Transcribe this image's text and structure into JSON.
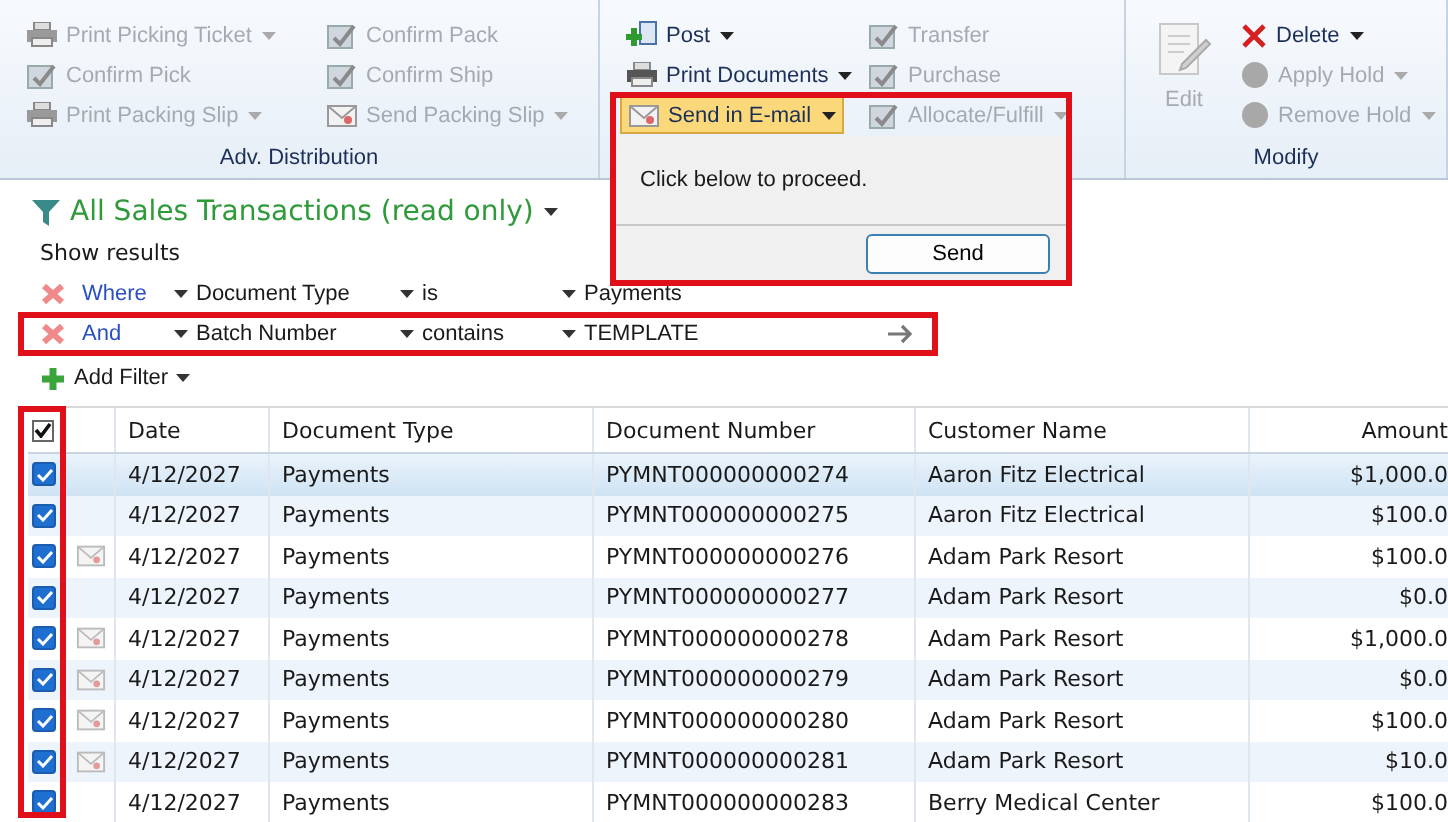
{
  "ribbon": {
    "groups": [
      {
        "label": "Adv. Distribution",
        "items": [
          {
            "label": "Print Picking Ticket",
            "dropdown": true,
            "disabled": true
          },
          {
            "label": "Confirm Pack",
            "dropdown": false,
            "disabled": true
          },
          {
            "label": "Confirm Pick",
            "dropdown": false,
            "disabled": true
          },
          {
            "label": "Confirm Ship",
            "dropdown": false,
            "disabled": true
          },
          {
            "label": "Print Packing Slip",
            "dropdown": true,
            "disabled": true
          },
          {
            "label": "Send Packing Slip",
            "dropdown": true,
            "disabled": true
          }
        ]
      },
      {
        "items": [
          {
            "label": "Post",
            "dropdown": true,
            "disabled": false
          },
          {
            "label": "Transfer",
            "dropdown": false,
            "disabled": true
          },
          {
            "label": "Print Documents",
            "dropdown": true,
            "disabled": false
          },
          {
            "label": "Purchase",
            "dropdown": false,
            "disabled": true
          },
          {
            "label": "Send in E-mail",
            "dropdown": true,
            "disabled": false,
            "highlighted": true
          },
          {
            "label": "Allocate/Fulfill",
            "dropdown": true,
            "disabled": true
          }
        ]
      },
      {
        "label": "Modify",
        "large_item": {
          "label": "Edit",
          "disabled": true
        },
        "items": [
          {
            "label": "Delete",
            "dropdown": true,
            "disabled": false
          },
          {
            "label": "Apply Hold",
            "dropdown": true,
            "disabled": true
          },
          {
            "label": "Remove Hold",
            "dropdown": true,
            "disabled": true
          }
        ]
      }
    ]
  },
  "popup": {
    "message": "Click below to proceed.",
    "button": "Send"
  },
  "view": {
    "title": "All Sales Transactions (read only)",
    "subtitle": "Show results"
  },
  "filters": [
    {
      "connector": "Where",
      "field": "Document Type",
      "operator": "is",
      "value": "Payments",
      "highlighted": false
    },
    {
      "connector": "And",
      "field": "Batch Number",
      "operator": "contains",
      "value": "TEMPLATE",
      "highlighted": true
    }
  ],
  "add_filter": "Add Filter",
  "table": {
    "header_checked": true,
    "columns": [
      "Date",
      "Document Type",
      "Document Number",
      "Customer Name",
      "Amount"
    ],
    "rows": [
      {
        "checked": true,
        "selected": true,
        "emailed": false,
        "cells": [
          "4/12/2027",
          "Payments",
          "PYMNT000000000274",
          "Aaron Fitz Electrical",
          "$1,000.0"
        ]
      },
      {
        "checked": true,
        "selected": false,
        "emailed": false,
        "cells": [
          "4/12/2027",
          "Payments",
          "PYMNT000000000275",
          "Aaron Fitz Electrical",
          "$100.0"
        ]
      },
      {
        "checked": true,
        "selected": false,
        "emailed": true,
        "cells": [
          "4/12/2027",
          "Payments",
          "PYMNT000000000276",
          "Adam Park Resort",
          "$100.0"
        ]
      },
      {
        "checked": true,
        "selected": false,
        "emailed": false,
        "cells": [
          "4/12/2027",
          "Payments",
          "PYMNT000000000277",
          "Adam Park Resort",
          "$0.0"
        ]
      },
      {
        "checked": true,
        "selected": false,
        "emailed": true,
        "cells": [
          "4/12/2027",
          "Payments",
          "PYMNT000000000278",
          "Adam Park Resort",
          "$1,000.0"
        ]
      },
      {
        "checked": true,
        "selected": false,
        "emailed": true,
        "cells": [
          "4/12/2027",
          "Payments",
          "PYMNT000000000279",
          "Adam Park Resort",
          "$0.0"
        ]
      },
      {
        "checked": true,
        "selected": false,
        "emailed": true,
        "cells": [
          "4/12/2027",
          "Payments",
          "PYMNT000000000280",
          "Adam Park Resort",
          "$100.0"
        ]
      },
      {
        "checked": true,
        "selected": false,
        "emailed": true,
        "cells": [
          "4/12/2027",
          "Payments",
          "PYMNT000000000281",
          "Adam Park Resort",
          "$10.0"
        ]
      },
      {
        "checked": true,
        "selected": false,
        "emailed": false,
        "cells": [
          "4/12/2027",
          "Payments",
          "PYMNT000000000283",
          "Berry Medical Center",
          "$100.0"
        ]
      }
    ]
  }
}
